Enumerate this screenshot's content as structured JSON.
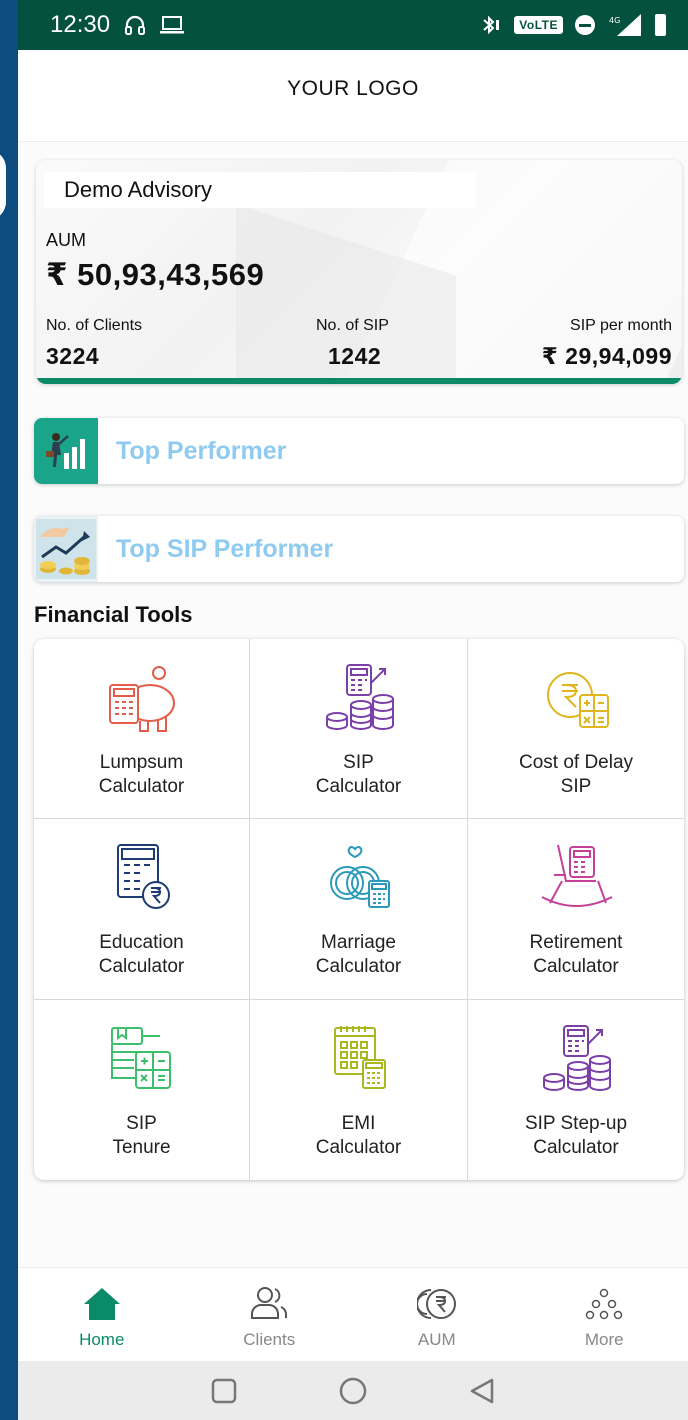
{
  "status_bar": {
    "time": "12:30",
    "network": "VoLTE",
    "signal": "4G"
  },
  "header": {
    "logo_text": "YOUR LOGO"
  },
  "summary": {
    "org_name": "Demo Advisory",
    "aum_label": "AUM",
    "aum_value": "₹ 50,93,43,569",
    "clients_label": "No. of Clients",
    "clients_value": "3224",
    "sip_count_label": "No. of SIP",
    "sip_count_value": "1242",
    "sip_month_label": "SIP per month",
    "sip_month_value": "₹ 29,94,099"
  },
  "performers": [
    {
      "label": "Top Performer"
    },
    {
      "label": "Top SIP Performer"
    }
  ],
  "financial_tools": {
    "title": "Financial Tools",
    "tools": [
      {
        "line1": "Lumpsum",
        "line2": "Calculator"
      },
      {
        "line1": "SIP",
        "line2": "Calculator"
      },
      {
        "line1": "Cost of Delay",
        "line2": "SIP"
      },
      {
        "line1": "Education",
        "line2": "Calculator"
      },
      {
        "line1": "Marriage",
        "line2": "Calculator"
      },
      {
        "line1": "Retirement",
        "line2": "Calculator"
      },
      {
        "line1": "SIP",
        "line2": "Tenure"
      },
      {
        "line1": "EMI",
        "line2": "Calculator"
      },
      {
        "line1": "SIP Step-up",
        "line2": "Calculator"
      }
    ]
  },
  "bottom_nav": [
    {
      "label": "Home",
      "active": true
    },
    {
      "label": "Clients",
      "active": false
    },
    {
      "label": "AUM",
      "active": false
    },
    {
      "label": "More",
      "active": false
    }
  ],
  "colors": {
    "primary": "#0b8a6a",
    "status_bar": "#05513f",
    "performer_text": "#8fcbf0"
  }
}
